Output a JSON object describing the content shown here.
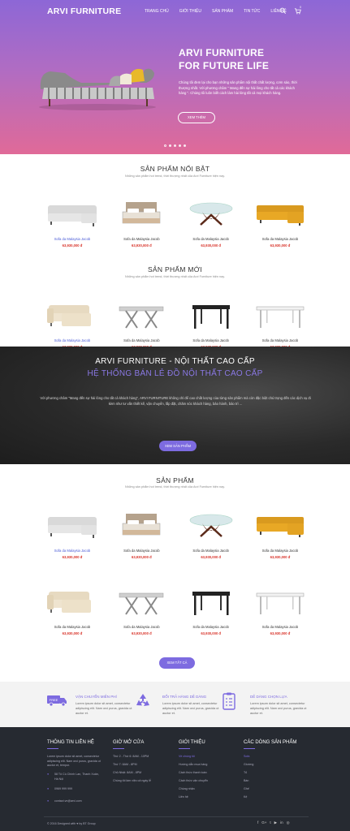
{
  "nav": {
    "logo": "ARVI FURNITURE",
    "menu": [
      "TRANG CHỦ",
      "GIỚI THIỆU",
      "SẢN PHẨM",
      "TIN TỨC",
      "LIÊN HỆ"
    ],
    "cart_count": "0"
  },
  "hero": {
    "title_line1": "ARVI FURNITURE",
    "title_line2": "FOR FUTURE LIFE",
    "description": "Chúng tôi đem lại cho bạn những sản phẩm nội thất chất lượng, cơm sáo, thời thượng nhất. Với phương châm \" Mang đến sự hài lòng cho tất cả các khách hàng \". Chúng tôi luôn biết cách làm hài lòng tất cả mọi khách hàng.",
    "button": "XEM THÊM",
    "slides": 5,
    "active_slide": 1
  },
  "featured": {
    "title": "SẢN PHẨM NỔI BẬT",
    "subtitle": "Những sản phẩm hot trend, thời thượng nhất của Arvi Furniture hiện nay.",
    "products": [
      {
        "name": "Sofa da Malaysia Jacob",
        "price": "63,930,000 đ",
        "icon": "white-sofa",
        "highlight": true
      },
      {
        "name": "Sofa da Malaysia Jacob",
        "price": "63,930,000 đ",
        "icon": "bed",
        "highlight": false
      },
      {
        "name": "Sofa da Malaysia Jacob",
        "price": "63,930,000 đ",
        "icon": "glass-table",
        "highlight": false
      },
      {
        "name": "Sofa da Malaysia Jacob",
        "price": "63,930,000 đ",
        "icon": "yellow-sofa",
        "highlight": false
      }
    ]
  },
  "new_products": {
    "title": "SẢN PHẨM MỚI",
    "subtitle": "Những sản phẩm hot trend, thời thượng nhất của Arvi Furniture hiện nay.",
    "products": [
      {
        "name": "Sofa da Malaysia Jacob",
        "price": "63,930,000 đ",
        "icon": "cream-sofa",
        "highlight": true
      },
      {
        "name": "Sofa da Malaysia Jacob",
        "price": "63,930,000 đ",
        "icon": "stone-table",
        "highlight": false
      },
      {
        "name": "Sofa da Malaysia Jacob",
        "price": "63,930,000 đ",
        "icon": "black-table",
        "highlight": false
      },
      {
        "name": "Sofa da Malaysia Jacob",
        "price": "63,930,000 đ",
        "icon": "white-table",
        "highlight": false
      }
    ]
  },
  "banner": {
    "title1": "ARVI FURNITURE - NỘI THẤT CAO CẤP",
    "title2": "HỆ THỐNG BÁN LẺ ĐỒ NỘI THẤT CAO CẤP",
    "description": "Với phương châm \"Mang đến sự hài lòng cho tất cả khách hàng\", ARVI FURNITURE không chỉ để cao chất lượng của từng sản phẩm mà còn đặc biệt chú trọng đến các dịch vụ đi kèm như tư vấn thiết kế, vận chuyển, lắp đặt, chăm sóc khách hàng, bảo hành, bảo trì ...",
    "button": "XEM SẢN PHẨM"
  },
  "products_section": {
    "title": "SẢN PHẨM",
    "subtitle": "Những sản phẩm hot trend, thời thượng nhất của Arvi Furniture hiện nay.",
    "row1": [
      {
        "name": "Sofa da Malaysia Jacob",
        "price": "63,930,000 đ",
        "icon": "white-sofa",
        "highlight": true
      },
      {
        "name": "Sofa da Malaysia Jacob",
        "price": "63,930,000 đ",
        "icon": "bed",
        "highlight": false
      },
      {
        "name": "Sofa da Malaysia Jacob",
        "price": "63,930,000 đ",
        "icon": "glass-table",
        "highlight": false
      },
      {
        "name": "Sofa da Malaysia Jacob",
        "price": "63,930,000 đ",
        "icon": "yellow-sofa",
        "highlight": false
      }
    ],
    "row2": [
      {
        "name": "Sofa da Malaysia Jacob",
        "price": "63,930,000 đ",
        "icon": "cream-sofa",
        "highlight": false
      },
      {
        "name": "Sofa da Malaysia Jacob",
        "price": "63,930,000 đ",
        "icon": "stone-table",
        "highlight": false
      },
      {
        "name": "Sofa da Malaysia Jacob",
        "price": "63,930,000 đ",
        "icon": "black-table",
        "highlight": false
      },
      {
        "name": "Sofa da Malaysia Jacob",
        "price": "63,930,000 đ",
        "icon": "white-table",
        "highlight": false
      }
    ],
    "button": "XEM TẤT CẢ"
  },
  "features": [
    {
      "title": "VẬN CHUYỂN MIỄN PHÍ",
      "desc": "Lorem ipsum dolor sit amet, consectetur adipiscing elit. Nam orci purus, gravida ut auctor et.",
      "icon": "truck-icon"
    },
    {
      "title": "ĐỔI TRẢ HÀNG DỄ DÀNG",
      "desc": "Lorem ipsum dolor sit amet, consectetur adipiscing elit. Nam orci purus, gravida ut auctor et.",
      "icon": "recycle-icon"
    },
    {
      "title": "DỄ DÀNG CHỌN LỰA",
      "desc": "Lorem ipsum dolor sit amet, consectetur adipiscing elit. Nam orci purus, gravida ut auctor et.",
      "icon": "checklist-icon"
    }
  ],
  "footer": {
    "contact_title": "THÔNG TIN LIÊN HỆ",
    "contact_text": "Lorem ipsum dolor sit amet, consectetur adipiscing elit. Nam orci purus, gravida ut auctor et, tempor.",
    "address": "58 Tô Cù Chính Lan, Thanh Xuân, Hà Nội",
    "phone": "0969 999 999",
    "email": "contact.vn@arvi.com",
    "hours_title": "GIỜ MỞ CỬA",
    "hours": [
      "Thứ 2 - Thứ 6: 8AM - 10PM",
      "Thứ 7: 8AM - 8PM",
      "Chủ Nhật: 8AM - 8PM",
      "Chúng tôi làm việc cả ngày lễ"
    ],
    "about_title": "GIỚI THIỆU",
    "about_links": [
      "Về chúng tôi",
      "Hướng dẫn mua hàng",
      "Cách thức thanh toán",
      "Cách thức vận chuyển",
      "Chúng nhận",
      "Liên hệ"
    ],
    "cat_title": "CÁC DÒNG SẢN PHẨM",
    "cat_links": [
      "Sofa",
      "Giường",
      "Tủ",
      "Bàn",
      "Ghế",
      "Kệ"
    ],
    "copyright": "© 2016 Designed with ♥ by BT Group",
    "social": [
      "f",
      "G+",
      "t",
      "▶",
      "in",
      "◎"
    ]
  },
  "colors": {
    "accent": "#7d6be0",
    "price": "#d8342b",
    "footer_bg": "#262a31"
  }
}
